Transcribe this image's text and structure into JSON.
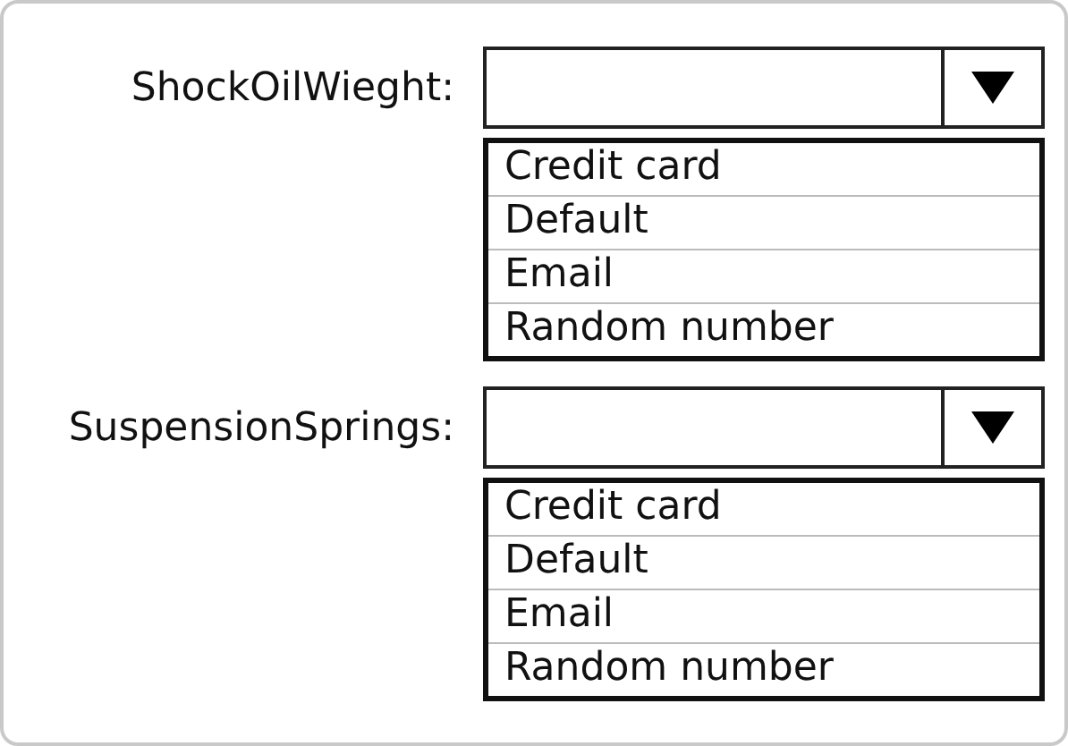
{
  "fields": [
    {
      "label": "ShockOilWieght:",
      "options": [
        "Credit card",
        "Default",
        "Email",
        "Random number"
      ]
    },
    {
      "label": "SuspensionSprings:",
      "options": [
        "Credit card",
        "Default",
        "Email",
        "Random number"
      ]
    }
  ]
}
